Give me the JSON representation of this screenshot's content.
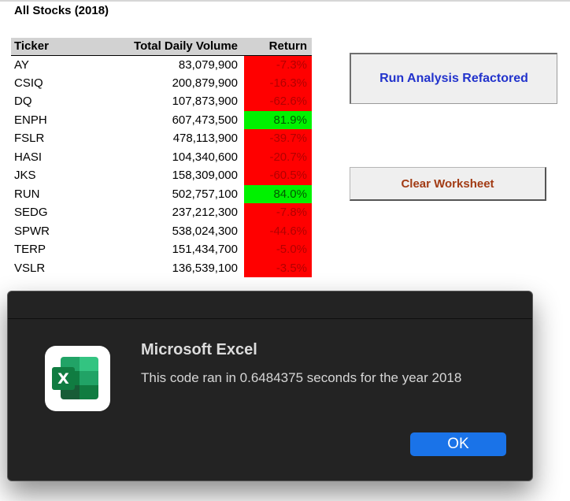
{
  "sheet": {
    "title": "All Stocks (2018)"
  },
  "table": {
    "headers": {
      "ticker": "Ticker",
      "volume": "Total Daily Volume",
      "return": "Return"
    },
    "rows": [
      {
        "ticker": "AY",
        "volume": "83,079,900",
        "return": "-7.3%",
        "status": "negative"
      },
      {
        "ticker": "CSIQ",
        "volume": "200,879,900",
        "return": "-16.3%",
        "status": "negative"
      },
      {
        "ticker": "DQ",
        "volume": "107,873,900",
        "return": "-62.6%",
        "status": "negative"
      },
      {
        "ticker": "ENPH",
        "volume": "607,473,500",
        "return": "81.9%",
        "status": "positive"
      },
      {
        "ticker": "FSLR",
        "volume": "478,113,900",
        "return": "-39.7%",
        "status": "negative"
      },
      {
        "ticker": "HASI",
        "volume": "104,340,600",
        "return": "-20.7%",
        "status": "negative"
      },
      {
        "ticker": "JKS",
        "volume": "158,309,000",
        "return": "-60.5%",
        "status": "negative"
      },
      {
        "ticker": "RUN",
        "volume": "502,757,100",
        "return": "84.0%",
        "status": "positive"
      },
      {
        "ticker": "SEDG",
        "volume": "237,212,300",
        "return": "-7.8%",
        "status": "negative"
      },
      {
        "ticker": "SPWR",
        "volume": "538,024,300",
        "return": "-44.6%",
        "status": "negative"
      },
      {
        "ticker": "TERP",
        "volume": "151,434,700",
        "return": "-5.0%",
        "status": "negative"
      },
      {
        "ticker": "VSLR",
        "volume": "136,539,100",
        "return": "-3.5%",
        "status": "negative"
      }
    ]
  },
  "buttons": {
    "run_analysis": "Run Analysis Refactored",
    "clear_worksheet": "Clear Worksheet"
  },
  "dialog": {
    "app_icon": "excel-app-icon",
    "icon_letter": "X",
    "title": "Microsoft Excel",
    "message": "This code ran in 0.6484375 seconds for the year 2018",
    "ok_label": "OK"
  },
  "colors": {
    "negative_fill": "#ff0000",
    "positive_fill": "#00f200",
    "run_button_text": "#2233cc",
    "clear_button_text": "#a23b14",
    "dialog_bg": "#232323",
    "ok_button": "#1a73e8"
  }
}
